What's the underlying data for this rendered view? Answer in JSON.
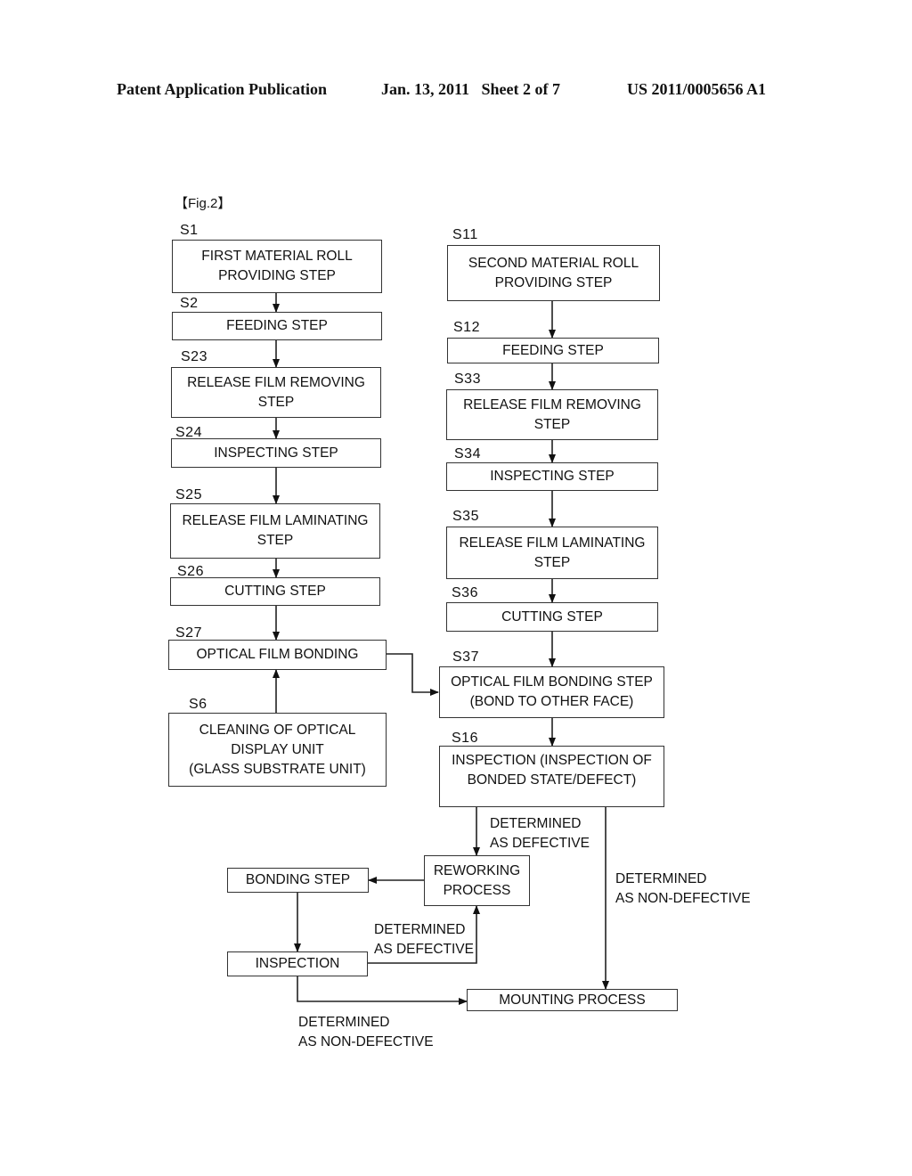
{
  "header": {
    "publication": "Patent Application Publication",
    "date_sheet": "Jan. 13, 2011   Sheet 2 of 7",
    "number": "US 2011/0005656 A1"
  },
  "figure_label": "【Fig.2】",
  "steps": {
    "s1": {
      "id": "S1",
      "text": "FIRST MATERIAL ROLL\nPROVIDING STEP"
    },
    "s2": {
      "id": "S2",
      "text": "FEEDING STEP"
    },
    "s23": {
      "id": "S23",
      "text": "RELEASE FILM REMOVING\nSTEP"
    },
    "s24": {
      "id": "S24",
      "text": "INSPECTING STEP"
    },
    "s25": {
      "id": "S25",
      "text": "RELEASE FILM LAMINATING\nSTEP"
    },
    "s26": {
      "id": "S26",
      "text": "CUTTING STEP"
    },
    "s27": {
      "id": "S27",
      "text": "OPTICAL FILM BONDING"
    },
    "s6": {
      "id": "S6",
      "text": "CLEANING OF OPTICAL\nDISPLAY UNIT\n(GLASS SUBSTRATE UNIT)"
    },
    "s11": {
      "id": "S11",
      "text": "SECOND MATERIAL ROLL\nPROVIDING STEP"
    },
    "s12": {
      "id": "S12",
      "text": "FEEDING STEP"
    },
    "s33": {
      "id": "S33",
      "text": "RELEASE FILM REMOVING\nSTEP"
    },
    "s34": {
      "id": "S34",
      "text": "INSPECTING STEP"
    },
    "s35": {
      "id": "S35",
      "text": "RELEASE FILM LAMINATING\nSTEP"
    },
    "s36": {
      "id": "S36",
      "text": "CUTTING STEP"
    },
    "s37": {
      "id": "S37",
      "text": "OPTICAL FILM BONDING STEP\n(BOND TO OTHER FACE)"
    },
    "s16": {
      "id": "S16",
      "text": "INSPECTION (INSPECTION OF\nBONDED STATE/DEFECT)"
    }
  },
  "rework": {
    "reworking": "REWORKING\nPROCESS",
    "bonding": "BONDING STEP",
    "inspection": "INSPECTION",
    "mounting": "MOUNTING PROCESS"
  },
  "annotations": {
    "defective_1": "DETERMINED\nAS DEFECTIVE",
    "non_defective_1": "DETERMINED\nAS NON-DEFECTIVE",
    "defective_2": "DETERMINED\nAS DEFECTIVE",
    "non_defective_2": "DETERMINED\nAS NON-DEFECTIVE"
  }
}
